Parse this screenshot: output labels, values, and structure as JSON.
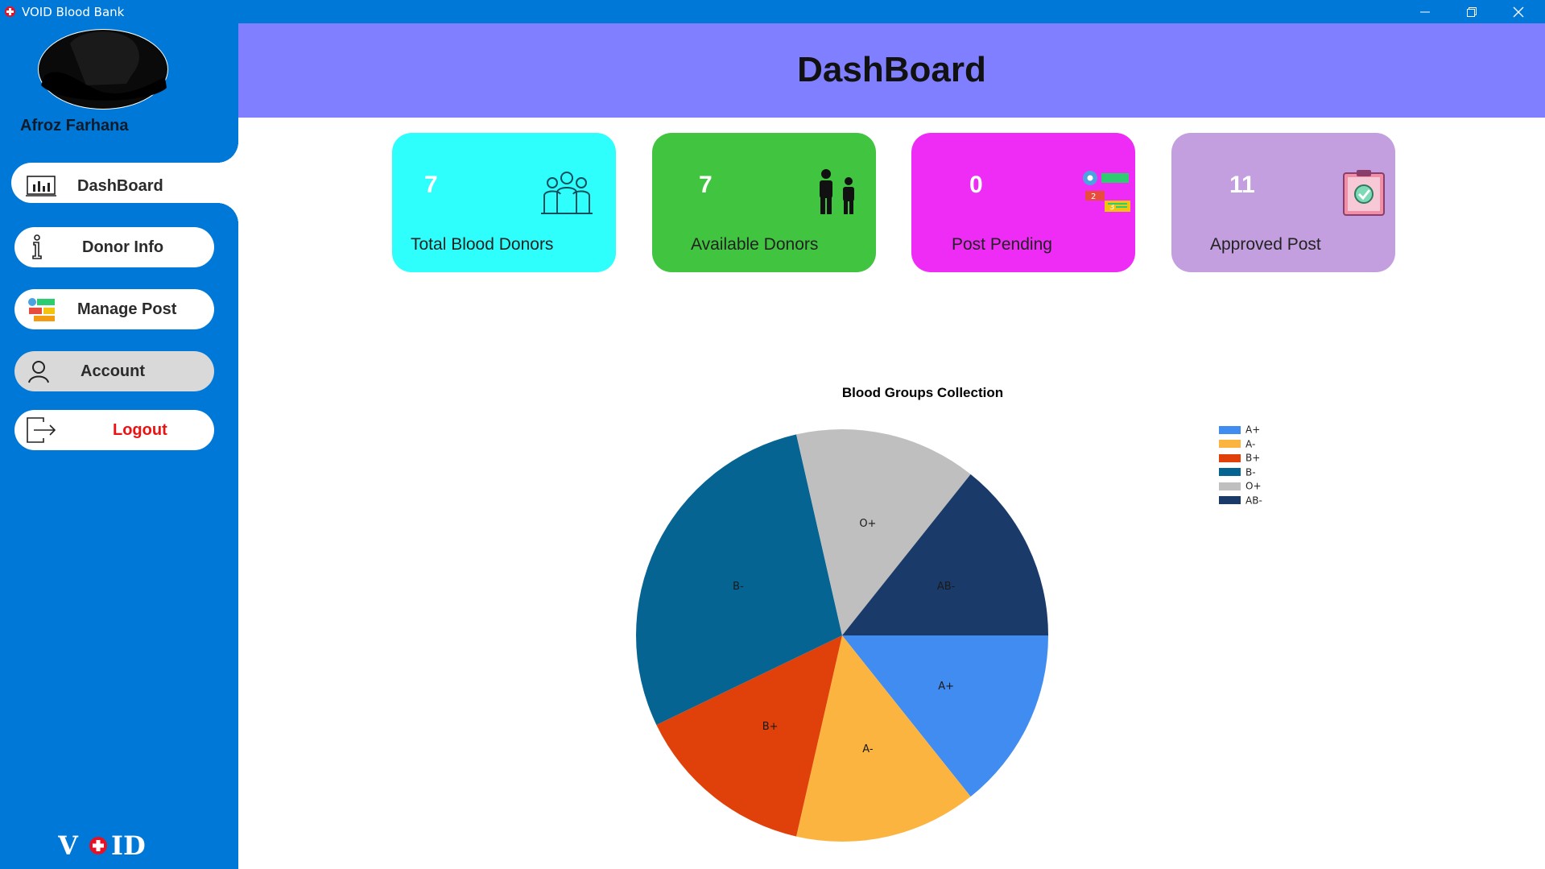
{
  "window": {
    "title": "VOID Blood Bank"
  },
  "sidebar": {
    "user_name": "Afroz Farhana",
    "items": [
      {
        "label": "DashBoard",
        "icon": "dashboard-chart-icon"
      },
      {
        "label": "Donor Info",
        "icon": "info-icon"
      },
      {
        "label": "Manage Post",
        "icon": "manage-post-icon"
      },
      {
        "label": "Account",
        "icon": "user-icon"
      },
      {
        "label": "Logout",
        "icon": "logout-icon"
      }
    ],
    "brand_logo": "VOID",
    "colors": {
      "sidebar": "#0078d7",
      "logout_text": "#ee1111"
    }
  },
  "header": {
    "title": "DashBoard",
    "background": "#7f7fff"
  },
  "cards": [
    {
      "value": "7",
      "label": "Total Blood Donors",
      "color": "#2ffffc",
      "icon": "group-icon"
    },
    {
      "value": "7",
      "label": "Available Donors",
      "color": "#41c43f",
      "icon": "people-icon"
    },
    {
      "value": "0",
      "label": "Post Pending",
      "color": "#ef2cf5",
      "icon": "pending-posts-icon"
    },
    {
      "value": "11",
      "label": "Approved Post",
      "color": "#c39fe0",
      "icon": "approved-clipboard-icon"
    }
  ],
  "chart_data": {
    "type": "pie",
    "title": "Blood Groups Collection",
    "legend_position": "right",
    "slices": [
      {
        "label": "A+",
        "value": 1,
        "color": "#418cf0"
      },
      {
        "label": "A-",
        "value": 1,
        "color": "#fcb441"
      },
      {
        "label": "B+",
        "value": 1,
        "color": "#e0400a"
      },
      {
        "label": "B-",
        "value": 2,
        "color": "#056492"
      },
      {
        "label": "O+",
        "value": 1,
        "color": "#bfbfbf"
      },
      {
        "label": "AB-",
        "value": 1,
        "color": "#1a3b69"
      }
    ]
  }
}
